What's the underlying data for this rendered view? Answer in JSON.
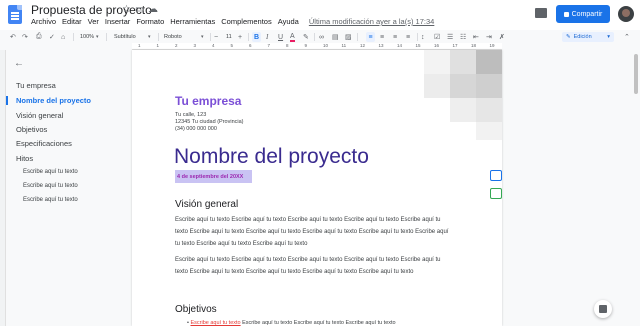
{
  "app": {
    "doc_title": "Propuesta de proyecto",
    "menu": [
      "Archivo",
      "Editar",
      "Ver",
      "Insertar",
      "Formato",
      "Herramientas",
      "Complementos",
      "Ayuda"
    ],
    "last_edit": "Última modificación ayer a la(s) 17:34",
    "share_label": "Compartir"
  },
  "toolbar": {
    "zoom": "100%",
    "style": "Subtítulo",
    "font": "Roboto",
    "font_size": "11",
    "bold": "B",
    "italic": "I",
    "underline": "U",
    "text_color": "A",
    "mode": "Edición"
  },
  "ruler": {
    "numbers": [
      "1",
      "1",
      "2",
      "3",
      "4",
      "5",
      "6",
      "7",
      "8",
      "9",
      "10",
      "11",
      "12",
      "13",
      "14",
      "15",
      "16",
      "17",
      "18",
      "19"
    ]
  },
  "outline": {
    "items": [
      {
        "label": "Tu empresa",
        "level": 1,
        "active": false
      },
      {
        "label": "Nombre del proyecto",
        "level": 1,
        "active": true
      },
      {
        "label": "Visión general",
        "level": 1,
        "active": false
      },
      {
        "label": "Objetivos",
        "level": 1,
        "active": false
      },
      {
        "label": "Especificaciones",
        "level": 1,
        "active": false
      },
      {
        "label": "Hitos",
        "level": 1,
        "active": false
      },
      {
        "label": "Escribe aquí tu texto",
        "level": 2,
        "active": false
      },
      {
        "label": "Escribe aquí tu texto",
        "level": 2,
        "active": false
      },
      {
        "label": "Escribe aquí tu texto",
        "level": 2,
        "active": false
      }
    ]
  },
  "document": {
    "company": "Tu empresa",
    "address_line1": "Tu calle, 123",
    "address_line2": "12345 Tu ciudad (Provincia)",
    "phone": "(34) 000 000 000",
    "project_name": "Nombre del proyecto",
    "date": "4 de septiembre del 20XX",
    "overview_heading": "Visión general",
    "overview_p1": "Escribe aquí tu texto Escribe aquí tu texto Escribe aquí tu texto Escribe aquí tu texto Escribe aquí tu texto Escribe aquí tu texto Escribe aquí tu texto Escribe aquí tu texto Escribe aquí tu texto Escribe aquí tu texto Escribe aquí tu texto Escribe aquí tu texto",
    "overview_p2": "Escribe aquí tu texto Escribe aquí tu texto Escribe aquí tu texto Escribe aquí tu texto Escribe aquí tu texto Escribe aquí tu texto Escribe aquí tu texto Escribe aquí tu texto Escribe aquí tu texto",
    "objectives_heading": "Objetivos",
    "bullet_highlight": "Escribe aquí tu texto",
    "bullet_rest": " Escribe aquí tu texto Escribe aquí tu texto Escribe aquí tu texto"
  },
  "colors": {
    "brand_blue": "#1a73e8",
    "company_purple": "#7b4fd6",
    "title_purple": "#3a2b8f",
    "date_highlight": "#c9c3f3",
    "add_comment_green": "#34a853"
  }
}
